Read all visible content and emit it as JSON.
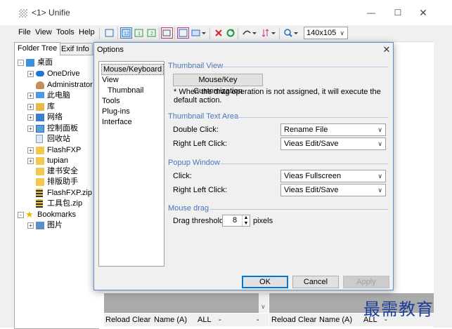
{
  "window": {
    "title": "<1> Unifie"
  },
  "menu": [
    "File",
    "View",
    "Tools",
    "Help"
  ],
  "toolbar": {
    "size_value": "140x105"
  },
  "left_tabs": [
    "Folder Tree",
    "Exif Info"
  ],
  "tree": [
    {
      "label": "桌面"
    },
    {
      "label": "OneDrive"
    },
    {
      "label": "Administrator"
    },
    {
      "label": "此电脑"
    },
    {
      "label": "库"
    },
    {
      "label": "网络"
    },
    {
      "label": "控制面板"
    },
    {
      "label": "回收站"
    },
    {
      "label": "FlashFXP"
    },
    {
      "label": "tupian"
    },
    {
      "label": "建书安全"
    },
    {
      "label": "排版助手"
    },
    {
      "label": "FlashFXP.zip"
    },
    {
      "label": "工具包.zip"
    },
    {
      "label": "Bookmarks"
    },
    {
      "label": "图片"
    }
  ],
  "statusbar_left": [
    "Reload",
    "Clear",
    "Name (A)",
    "ALL",
    "-",
    "-"
  ],
  "statusbar_right": [
    "Reload",
    "Clear",
    "Name (A)",
    "ALL",
    "-"
  ],
  "dialog": {
    "title": "Options",
    "nav": [
      "Mouse/Keyboard",
      "View",
      "Thumbnail",
      "Tools",
      "Plug-ins",
      "Interface"
    ],
    "sections": {
      "thumbnail_view": {
        "heading": "Thumbnail View",
        "button": "Mouse/Key Customization",
        "note": "* When the drag operation is not assigned, it will execute the default action."
      },
      "thumbnail_text": {
        "heading": "Thumbnail Text Area",
        "double_click_label": "Double Click:",
        "double_click_value": "Rename File",
        "right_left_label": "Right  Left Click:",
        "right_left_value": "Vieas Edit/Save"
      },
      "popup": {
        "heading": "Popup Window",
        "click_label": "Click:",
        "click_value": "Vieas Fullscreen",
        "right_left_label": "Right  Left Click:",
        "right_left_value": "Vieas Edit/Save"
      },
      "mouse_drag": {
        "heading": "Mouse drag",
        "threshold_label": "Drag threshold:",
        "threshold_value": "8",
        "unit": "pixels"
      }
    },
    "buttons": {
      "ok": "OK",
      "cancel": "Cancel",
      "apply": "Apply"
    }
  },
  "watermark": "最需教育"
}
